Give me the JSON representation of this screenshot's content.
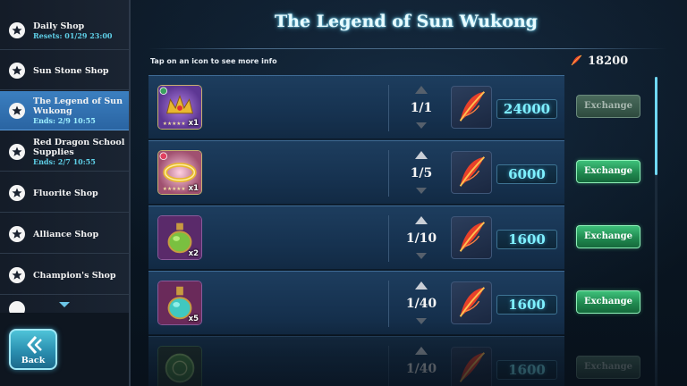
{
  "sidebar": {
    "items": [
      {
        "label": "Daily Shop",
        "sub": "Resets: 01/29 23:00",
        "active": false
      },
      {
        "label": "Sun Stone Shop",
        "sub": "",
        "active": false
      },
      {
        "label": "The Legend of Sun Wukong",
        "sub": "Ends: 2/9 10:55",
        "active": true
      },
      {
        "label": "Red Dragon School Supplies",
        "sub": "Ends: 2/7 10:55",
        "active": false
      },
      {
        "label": "Fluorite Shop",
        "sub": "",
        "active": false
      },
      {
        "label": "Alliance Shop",
        "sub": "",
        "active": false
      },
      {
        "label": "Champion's Shop",
        "sub": "",
        "active": false
      }
    ]
  },
  "back_button": {
    "label": "Back"
  },
  "header": {
    "title": "The Legend of Sun Wukong",
    "hint": "Tap on an icon to see more info"
  },
  "currency": {
    "amount": "18200",
    "icon": "red-feather-icon"
  },
  "items": [
    {
      "icon": "golden-crown-icon",
      "qty": "x1",
      "stock": "1/1",
      "cost": "24000",
      "exchange_label": "Exchange",
      "exchange_enabled": false
    },
    {
      "icon": "golden-headband-icon",
      "qty": "x1",
      "stock": "1/5",
      "cost": "6000",
      "exchange_label": "Exchange",
      "exchange_enabled": true
    },
    {
      "icon": "green-potion-icon",
      "qty": "x2",
      "stock": "1/10",
      "cost": "1600",
      "exchange_label": "Exchange",
      "exchange_enabled": true
    },
    {
      "icon": "blue-potion-icon",
      "qty": "x5",
      "stock": "1/40",
      "cost": "1600",
      "exchange_label": "Exchange",
      "exchange_enabled": true
    },
    {
      "icon": "green-token-icon",
      "qty": "",
      "stock": "1/40",
      "cost": "1600",
      "exchange_label": "Exchange",
      "exchange_enabled": false
    }
  ],
  "colors": {
    "accent_cyan": "#7ff0ff",
    "active_tab": "#3b7fc0",
    "exchange_green": "#3ec07a"
  }
}
